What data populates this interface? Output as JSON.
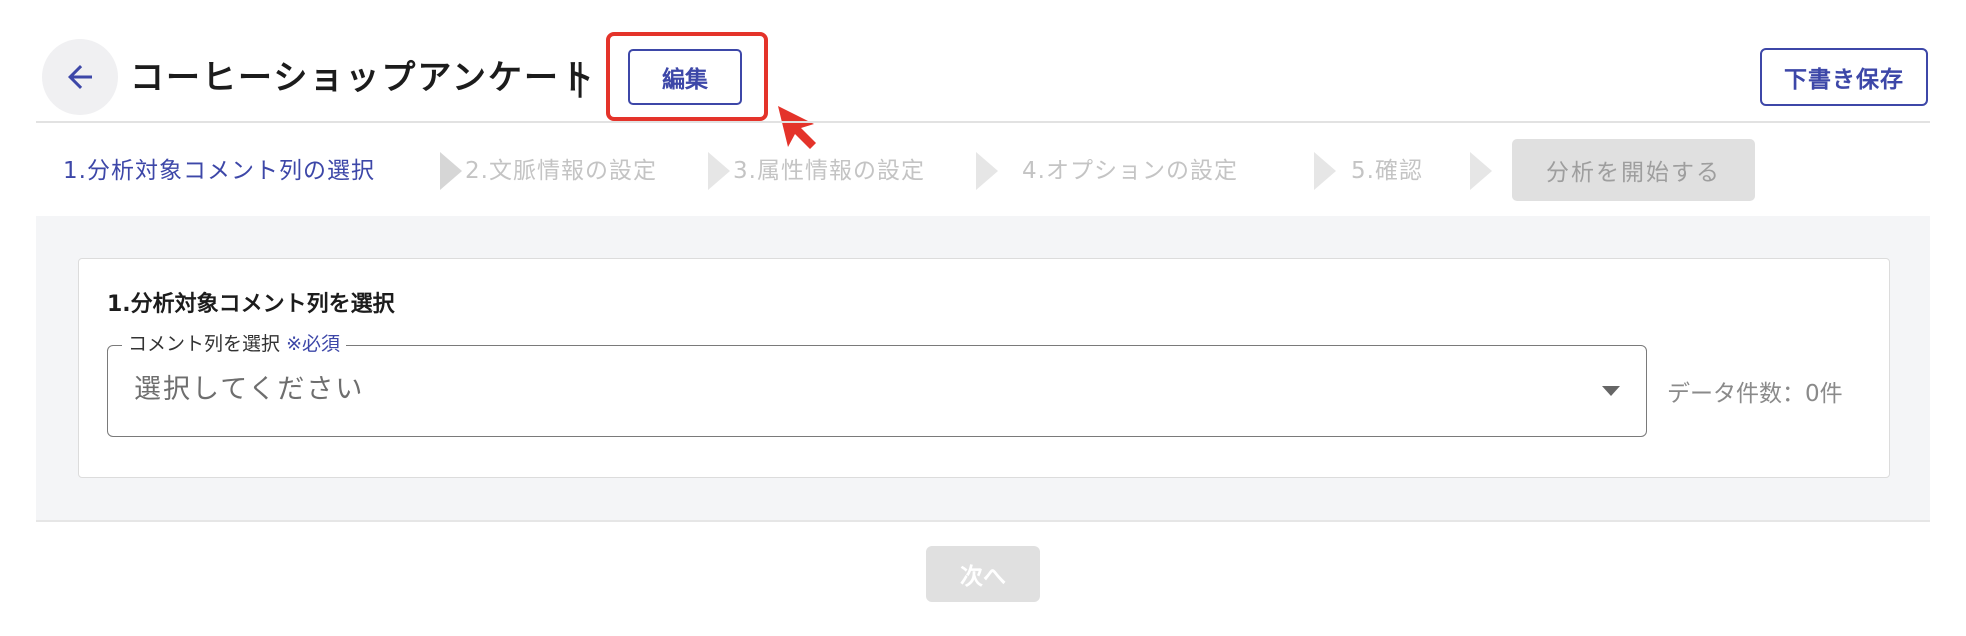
{
  "header": {
    "title": "コーヒーショップアンケート",
    "title_separator": "|",
    "edit_label": "編集",
    "draft_save_label": "下書き保存"
  },
  "steps": [
    {
      "label": "1.分析対象コメント列の選択",
      "state": "active"
    },
    {
      "label": "2.文脈情報の設定",
      "state": "disabled"
    },
    {
      "label": "3.属性情報の設定",
      "state": "disabled"
    },
    {
      "label": "4.オプションの設定",
      "state": "disabled"
    },
    {
      "label": "5.確認",
      "state": "disabled"
    }
  ],
  "start_analysis_label": "分析を開始する",
  "section": {
    "heading": "1.分析対象コメント列を選択",
    "select_label": "コメント列を選択",
    "required_mark": "※必須",
    "select_placeholder": "選択してください",
    "data_count": "データ件数：0件"
  },
  "next_label": "次へ",
  "colors": {
    "accent": "#3d47a8",
    "highlight": "#e4332a",
    "disabled_bg": "#e0e0e0",
    "disabled_text": "#c4c4c4",
    "panel_bg": "#f4f5f7"
  },
  "icons": {
    "back": "arrow-left-icon",
    "cursor": "mouse-cursor-icon",
    "step_separator": "chevron-right-icon",
    "dropdown": "caret-down-icon"
  }
}
